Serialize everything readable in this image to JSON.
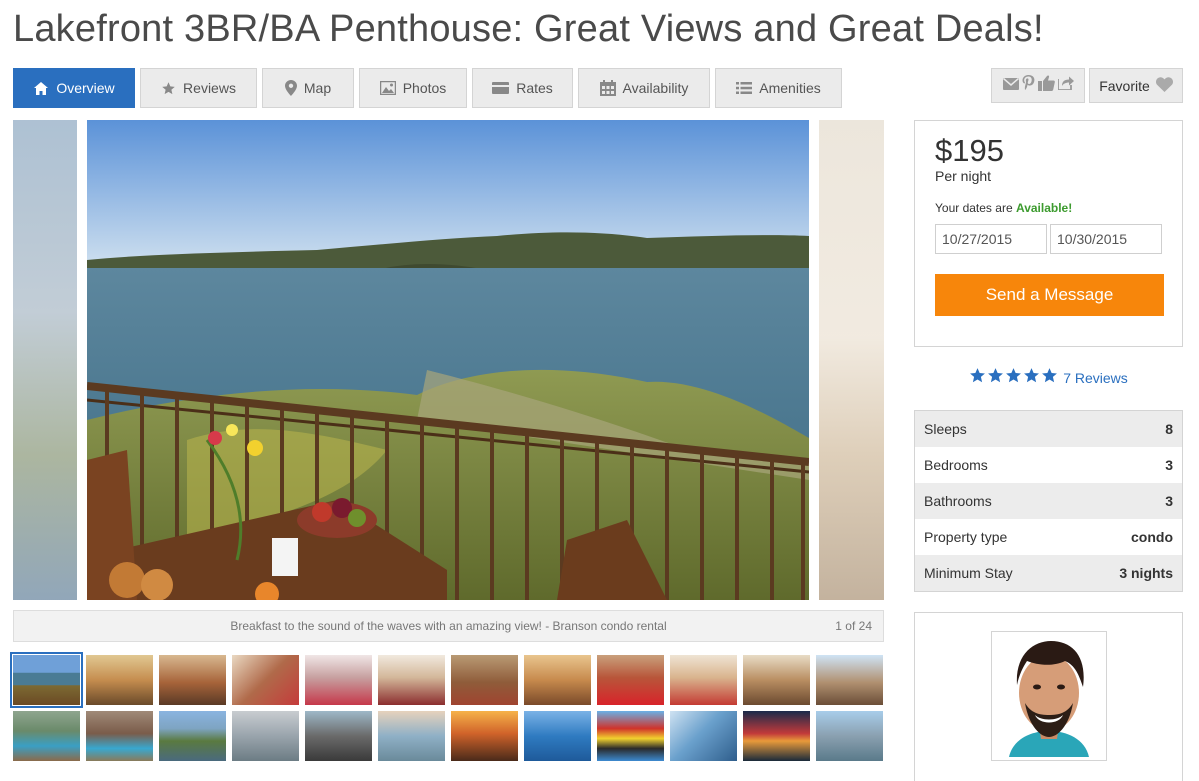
{
  "listing": {
    "title": "Lakefront 3BR/BA Penthouse: Great Views and Great Deals!"
  },
  "tabs": [
    {
      "label": "Overview",
      "icon": "home-icon",
      "active": true
    },
    {
      "label": "Reviews",
      "icon": "star-icon"
    },
    {
      "label": "Map",
      "icon": "map-pin-icon"
    },
    {
      "label": "Photos",
      "icon": "photo-icon"
    },
    {
      "label": "Rates",
      "icon": "credit-card-icon"
    },
    {
      "label": "Availability",
      "icon": "calendar-icon"
    },
    {
      "label": "Amenities",
      "icon": "list-icon"
    }
  ],
  "share": {
    "icons": [
      "email-icon",
      "pinterest-icon",
      "like-icon",
      "share-icon"
    ]
  },
  "favorite": {
    "label": "Favorite",
    "icon": "heart-icon"
  },
  "gallery": {
    "caption": "Breakfast to the sound of the waves with an amazing view! - Branson condo rental",
    "counter": "1 of 24"
  },
  "booking": {
    "price": "$195",
    "per_night": "Per night",
    "dates_prefix": "Your dates are",
    "dates_status": "Available!",
    "checkin": "10/27/2015",
    "checkout": "10/30/2015",
    "send_label": "Send a Message"
  },
  "rating": {
    "stars": 5,
    "reviews_label": "7 Reviews"
  },
  "specs": [
    {
      "label": "Sleeps",
      "value": "8"
    },
    {
      "label": "Bedrooms",
      "value": "3"
    },
    {
      "label": "Bathrooms",
      "value": "3"
    },
    {
      "label": "Property type",
      "value": "condo"
    },
    {
      "label": "Minimum Stay",
      "value": "3 nights"
    }
  ],
  "colors": {
    "accent": "#2a6fbf",
    "cta": "#f7860b",
    "available": "#3d9b2f",
    "star": "#2a6fbf"
  }
}
